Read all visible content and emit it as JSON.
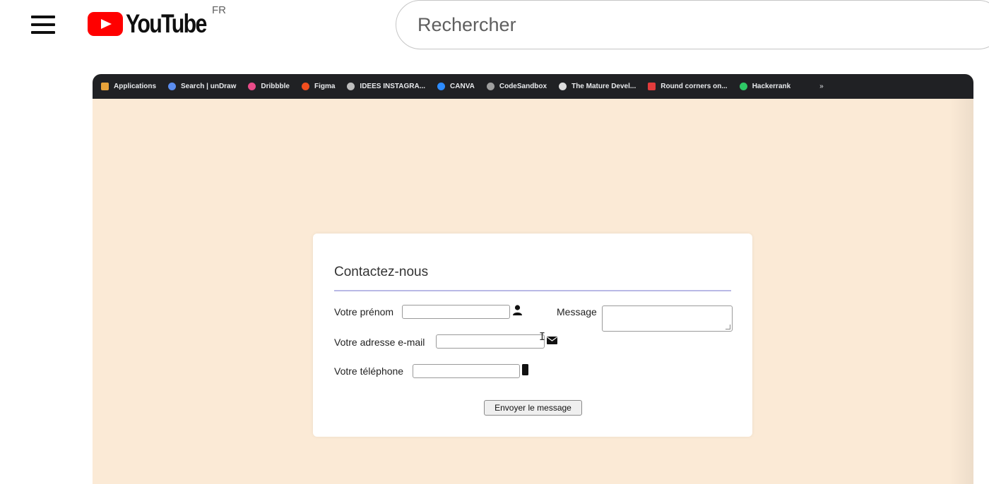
{
  "youtube": {
    "logo_text": "YouTube",
    "country": "FR",
    "search_placeholder": "Rechercher"
  },
  "bookmarks": [
    {
      "label": "Applications",
      "icon": "apps-grid-icon",
      "color": "#e8a33a"
    },
    {
      "label": "Search | unDraw",
      "icon": "undraw-icon",
      "color": "#5b8def"
    },
    {
      "label": "Dribbble",
      "icon": "dribbble-icon",
      "color": "#ea4c89"
    },
    {
      "label": "Figma",
      "icon": "figma-icon",
      "color": "#f24e1e"
    },
    {
      "label": "IDEES INSTAGRA...",
      "icon": "idees-icon",
      "color": "#bdbdbd"
    },
    {
      "label": "CANVA",
      "icon": "canva-icon",
      "color": "#2d8cff"
    },
    {
      "label": "CodeSandbox",
      "icon": "codesandbox-icon",
      "color": "#9e9e9e"
    },
    {
      "label": "The Mature Devel...",
      "icon": "dev-icon",
      "color": "#dddddd"
    },
    {
      "label": "Round corners on...",
      "icon": "bookmark-red-icon",
      "color": "#e23c3c"
    },
    {
      "label": "Hackerrank",
      "icon": "hackerrank-icon",
      "color": "#2ec866"
    }
  ],
  "bookmarks_more": "»",
  "contact": {
    "title": "Contactez-nous",
    "first_name_label": "Votre prénom",
    "email_label": "Votre adresse e-mail",
    "phone_label": "Votre téléphone",
    "message_label": "Message",
    "submit_label": "Envoyer le message"
  },
  "colors": {
    "page_background": "#fbead6",
    "youtube_red": "#ff0000",
    "divider": "#b9b9e6"
  }
}
